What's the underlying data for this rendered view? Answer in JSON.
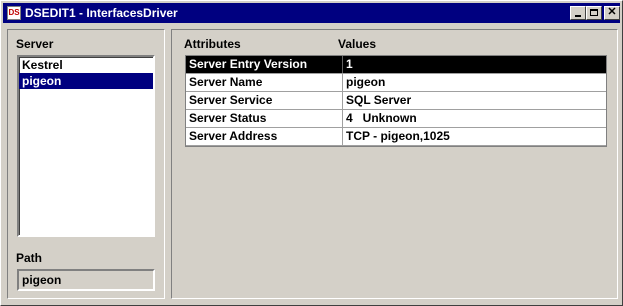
{
  "window": {
    "title": "DSEDIT1 - InterfacesDriver",
    "icon": "app-icon"
  },
  "left": {
    "server_label": "Server",
    "servers": [
      {
        "name": "Kestrel",
        "selected": false
      },
      {
        "name": "pigeon",
        "selected": true
      }
    ],
    "path_label": "Path",
    "path_value": "pigeon"
  },
  "right": {
    "attributes_header": "Attributes",
    "values_header": "Values",
    "rows": [
      {
        "attribute": "Server Entry Version",
        "value": "1",
        "selected": true
      },
      {
        "attribute": "Server Name",
        "value": "pigeon",
        "selected": false
      },
      {
        "attribute": "Server Service",
        "value": "SQL Server",
        "selected": false
      },
      {
        "attribute": "Server Status",
        "value": "4   Unknown",
        "selected": false
      },
      {
        "attribute": "Server Address",
        "value": "TCP - pigeon,1025",
        "selected": false
      }
    ]
  },
  "colors": {
    "titlebar": "#000080",
    "selection": "#000080",
    "grid_selection": "#000000",
    "face": "#d4d0c8"
  }
}
